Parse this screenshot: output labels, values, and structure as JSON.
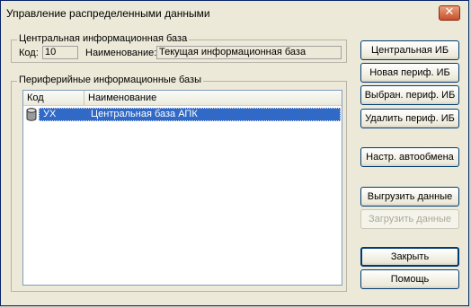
{
  "window": {
    "title": "Управление распределенными данными",
    "close_glyph": "✕"
  },
  "central": {
    "legend": "Центральная информационная база",
    "code_label": "Код:",
    "code_value": "10",
    "name_label": "Наименование:",
    "name_value": "Текущая информационная база"
  },
  "peripheral": {
    "legend": "Периферийные информационные базы",
    "columns": [
      "Код",
      "Наименование"
    ],
    "rows": [
      {
        "code": "УХ",
        "name": "Центральная база АПК",
        "icon": "database-icon",
        "selected": true
      }
    ]
  },
  "buttons": {
    "central_ib": "Центральная ИБ",
    "new_periph": "Новая периф. ИБ",
    "selected_periph": "Выбран. периф. ИБ",
    "delete_periph": "Удалить периф. ИБ",
    "autoexchange": "Настр. автообмена",
    "unload": "Выгрузить данные",
    "load": "Загрузить данные",
    "close": "Закрыть",
    "help": "Помощь"
  },
  "colors": {
    "selection": "#3169c6",
    "window_bg": "#ece9d8"
  }
}
